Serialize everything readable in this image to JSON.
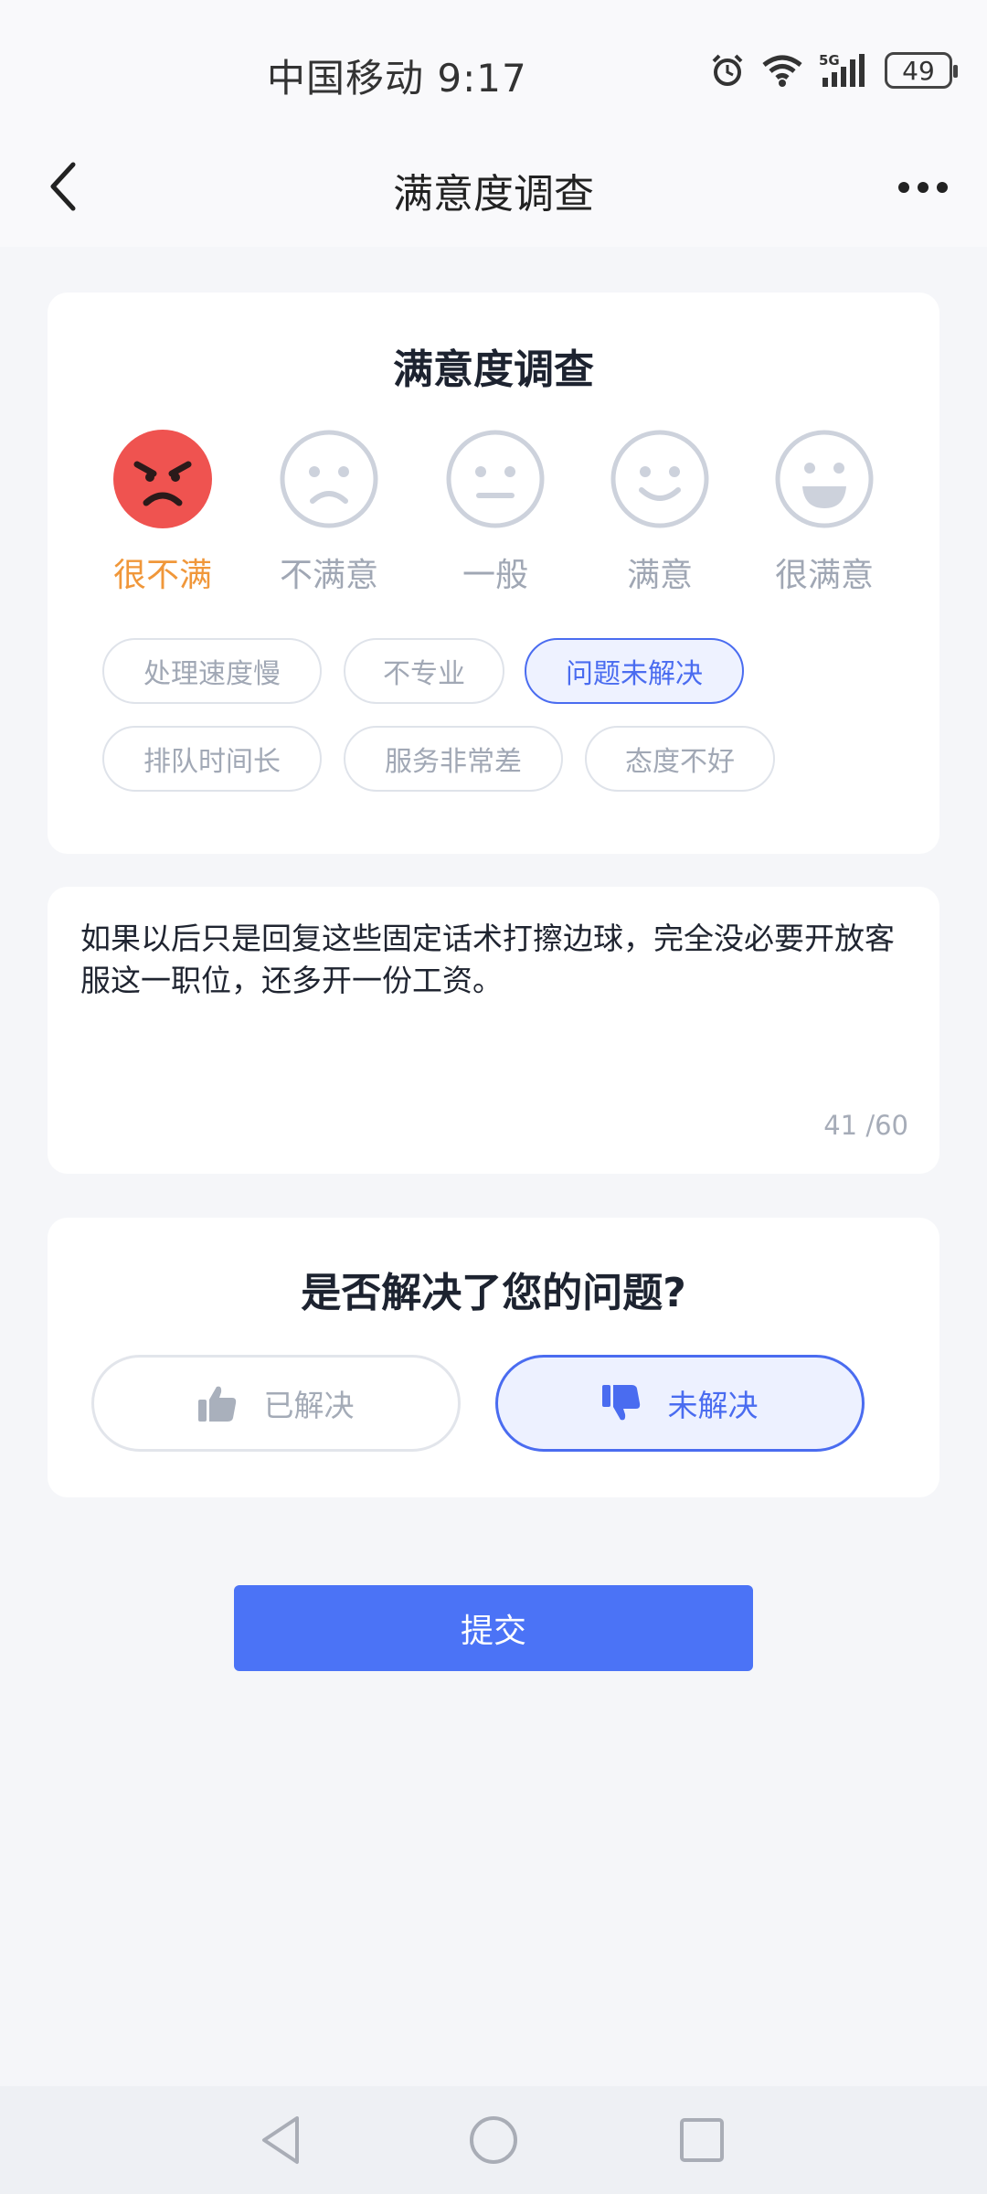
{
  "status_bar": {
    "carrier_time": "中国移动 9:17",
    "battery": "49",
    "icons": [
      "alarm-icon",
      "wifi-icon",
      "5g-signal-icon",
      "battery-icon"
    ]
  },
  "header": {
    "title": "满意度调查",
    "back_icon": "back-chevron-icon",
    "more_icon": "more-dots-icon"
  },
  "rating": {
    "title": "满意度调查",
    "options": [
      {
        "label": "很不满",
        "icon": "very-unsatisfied-face-icon",
        "selected": true
      },
      {
        "label": "不满意",
        "icon": "unsatisfied-face-icon",
        "selected": false
      },
      {
        "label": "一般",
        "icon": "neutral-face-icon",
        "selected": false
      },
      {
        "label": "满意",
        "icon": "satisfied-face-icon",
        "selected": false
      },
      {
        "label": "很满意",
        "icon": "very-satisfied-face-icon",
        "selected": false
      }
    ],
    "tags": [
      {
        "label": "处理速度慢",
        "selected": false
      },
      {
        "label": "不专业",
        "selected": false
      },
      {
        "label": "问题未解决",
        "selected": true
      },
      {
        "label": "排队时间长",
        "selected": false
      },
      {
        "label": "服务非常差",
        "selected": false
      },
      {
        "label": "态度不好",
        "selected": false
      }
    ]
  },
  "comment": {
    "text": "如果以后只是回复这些固定话术打擦边球，完全没必要开放客服这一职位，还多开一份工资。",
    "counter": "41 /60"
  },
  "resolution": {
    "title": "是否解决了您的问题?",
    "resolved_label": "已解决",
    "unresolved_label": "未解决",
    "selected": "unresolved"
  },
  "submit_label": "提交",
  "nav": {
    "back_icon": "nav-back-triangle-icon",
    "home_icon": "nav-home-circle-icon",
    "recents_icon": "nav-recents-square-icon"
  },
  "colors": {
    "accent": "#4b73f6",
    "angry_face": "#ef5350",
    "angry_label": "#f0973a"
  }
}
